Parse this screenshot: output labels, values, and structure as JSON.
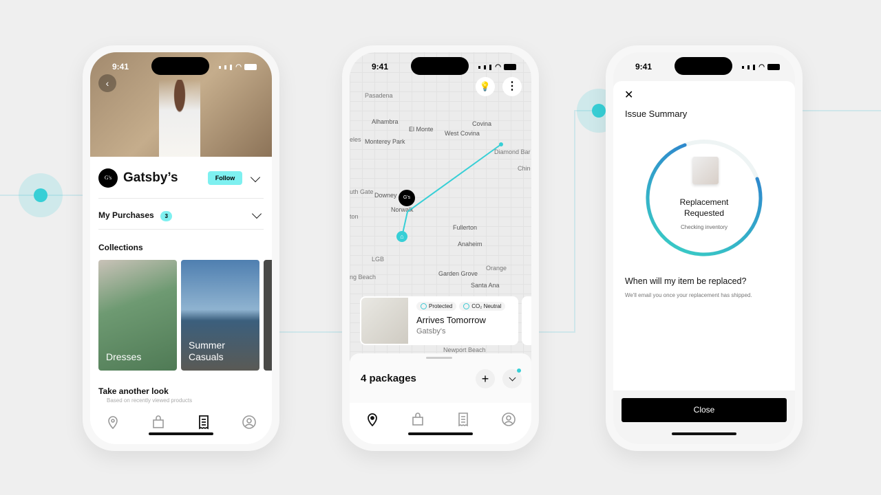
{
  "colors": {
    "accent": "#37cfd6",
    "follow_bg": "#7ef0f0",
    "primary": "#000000"
  },
  "phone1": {
    "time": "9:41",
    "store_logo": "G's",
    "store_name": "Gatsby’s",
    "follow_label": "Follow",
    "purchases_label": "My Purchases",
    "purchases_count": "3",
    "collections_title": "Collections",
    "collections": [
      {
        "label": "Dresses"
      },
      {
        "label": "Summer Casuals"
      }
    ],
    "take_another_look": "Take another look",
    "take_another_look_sub": "Based on recently viewed products",
    "tabs": [
      "location-pin-icon",
      "bag-icon",
      "receipt-icon",
      "profile-icon"
    ],
    "active_tab": 2
  },
  "phone2": {
    "time": "9:41",
    "map_labels": [
      "Pasadena",
      "Alhambra",
      "El Monte",
      "West Covina",
      "Covina",
      "eles",
      "Monterey Park",
      "Diamond Bar",
      "Chin",
      "uth Gate",
      "Downey",
      "Norwalk",
      "ton",
      "Fullerton",
      "Anaheim",
      "LGB",
      "Orange",
      "Garden Grove",
      "ng Beach",
      "Santa Ana",
      "Newport Beach"
    ],
    "map_pin_logo": "G's",
    "card": {
      "badge1": "Protected",
      "badge2": "CO₂ Neutral",
      "title": "Arrives Tomorrow",
      "store": "Gatsby's"
    },
    "packages_label": "4 packages",
    "tabs": [
      "location-pin-icon",
      "bag-icon",
      "receipt-icon",
      "profile-icon"
    ],
    "active_tab": 0
  },
  "phone3": {
    "time": "9:41",
    "title": "Issue Summary",
    "status_title": "Replacement Requested",
    "status_sub": "Checking inventory",
    "progress_percent": 75,
    "question": "When will my item be replaced?",
    "answer": "We'll email you once your replacement has shipped.",
    "close_label": "Close"
  }
}
